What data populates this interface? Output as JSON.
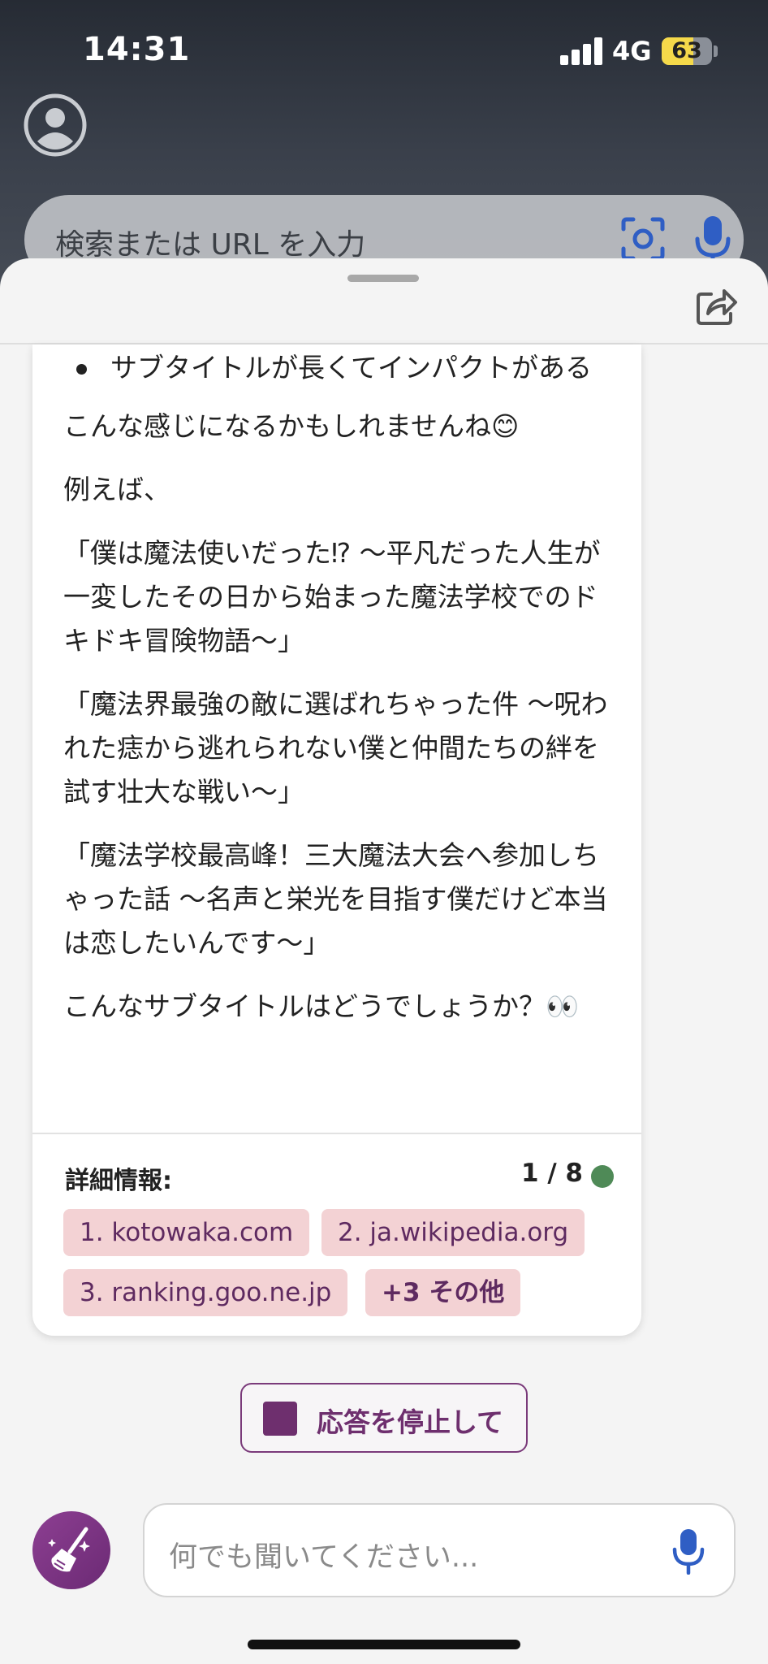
{
  "status_bar": {
    "time": "14:31",
    "network": "4G",
    "battery_level": "63",
    "battery_fraction": 0.63
  },
  "browser": {
    "search_placeholder": "検索または URL を入力",
    "account_icon": "person-circle-icon",
    "camera_search_icon": "camera-search-icon",
    "mic_icon": "microphone-icon"
  },
  "sheet": {
    "share_icon": "share-icon"
  },
  "message": {
    "bullet": "サブタイトルが長くてインパクトがある",
    "p1": "こんな感じになるかもしれませんね😊",
    "p2": "例えば、",
    "p3": "「僕は魔法使いだった⁉ 〜平凡だった人生が一変したその日から始まった魔法学校でのドキドキ冒険物語〜」",
    "p4": "「魔法界最強の敵に選ばれちゃった件 〜呪われた痣から逃れられない僕と仲間たちの絆を試す壮大な戦い〜」",
    "p5": "「魔法学校最高峰！三大魔法大会へ参加しちゃった話 〜名声と栄光を目指す僕だけど本当は恋したいんです〜」",
    "p6": "こんなサブタイトルはどうでしょうか？👀"
  },
  "details": {
    "label": "詳細情報:",
    "pager": "1 / 8",
    "status_color": "#4f8a57",
    "citations": [
      "1. kotowaka.com",
      "2. ja.wikipedia.org",
      "3. ranking.goo.ne.jp",
      "+3 その他"
    ]
  },
  "stop_button": {
    "label": "応答を停止して"
  },
  "chat": {
    "placeholder": "何でも聞いてください...",
    "new_topic_icon": "broom-icon",
    "mic_icon": "microphone-icon"
  },
  "colors": {
    "accent": "#6e2f6e",
    "citation_bg": "#f3d2d4",
    "mic_blue": "#2f5ec4"
  }
}
